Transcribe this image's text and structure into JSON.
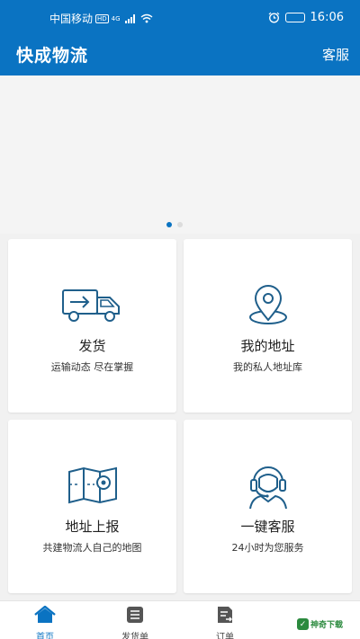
{
  "status_bar": {
    "carrier": "中国移动",
    "hd_badge": "HD",
    "network": "4G",
    "battery": "",
    "time": "16:06"
  },
  "header": {
    "title": "快成物流",
    "service_label": "客服"
  },
  "banner": {
    "page_count": 2,
    "active_index": 0
  },
  "cards": [
    {
      "title": "发货",
      "subtitle": "运输动态  尽在掌握",
      "icon": "truck-icon"
    },
    {
      "title": "我的地址",
      "subtitle": "我的私人地址库",
      "icon": "location-pin-icon"
    },
    {
      "title": "地址上报",
      "subtitle": "共建物流人自己的地图",
      "icon": "map-icon"
    },
    {
      "title": "一键客服",
      "subtitle": "24小时为您服务",
      "icon": "headset-agent-icon"
    }
  ],
  "tabs": [
    {
      "label": "首页",
      "icon": "home-icon",
      "active": true
    },
    {
      "label": "发货单",
      "icon": "list-icon",
      "active": false
    },
    {
      "label": "订单",
      "icon": "order-icon",
      "active": false
    }
  ],
  "watermark": {
    "text": "神奇下载",
    "badge": "✓"
  },
  "colors": {
    "primary": "#0a73c2",
    "icon_stroke": "#1f5f8b",
    "background": "#f1f1f1"
  }
}
